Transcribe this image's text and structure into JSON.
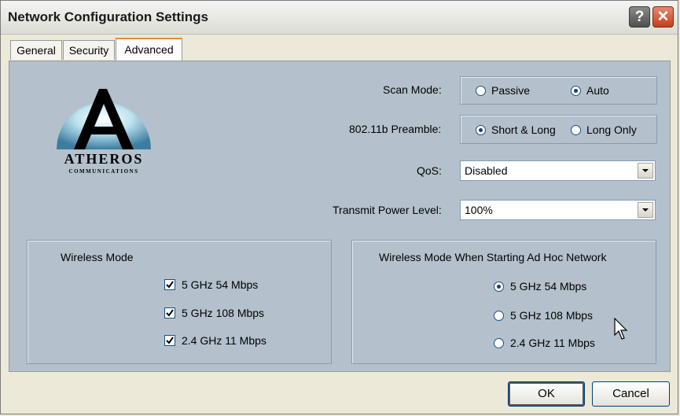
{
  "window": {
    "title": "Network Configuration Settings"
  },
  "tabs": [
    {
      "label": "General"
    },
    {
      "label": "Security"
    },
    {
      "label": "Advanced"
    }
  ],
  "logo": {
    "brand": "ATHEROS",
    "sub": "COMMUNICATIONS"
  },
  "scan_mode": {
    "label": "Scan Mode:",
    "options": [
      {
        "label": "Passive",
        "selected": false
      },
      {
        "label": "Auto",
        "selected": true
      }
    ]
  },
  "preamble": {
    "label": "802.11b Preamble:",
    "options": [
      {
        "label": "Short & Long",
        "selected": true
      },
      {
        "label": "Long Only",
        "selected": false
      }
    ]
  },
  "qos": {
    "label": "QoS:",
    "value": "Disabled"
  },
  "transmit_power": {
    "label": "Transmit Power Level:",
    "value": "100%"
  },
  "wireless_mode": {
    "title": "Wireless Mode",
    "options": [
      {
        "label": "5 GHz 54 Mbps",
        "checked": true
      },
      {
        "label": "5 GHz 108 Mbps",
        "checked": true
      },
      {
        "label": "2.4 GHz 11 Mbps",
        "checked": true
      }
    ]
  },
  "adhoc_mode": {
    "title": "Wireless Mode When Starting Ad Hoc Network",
    "options": [
      {
        "label": "5 GHz 54 Mbps",
        "selected": true
      },
      {
        "label": "5 GHz 108 Mbps",
        "selected": false
      },
      {
        "label": "2.4 GHz 11 Mbps",
        "selected": false
      }
    ]
  },
  "buttons": {
    "ok": "OK",
    "cancel": "Cancel"
  }
}
